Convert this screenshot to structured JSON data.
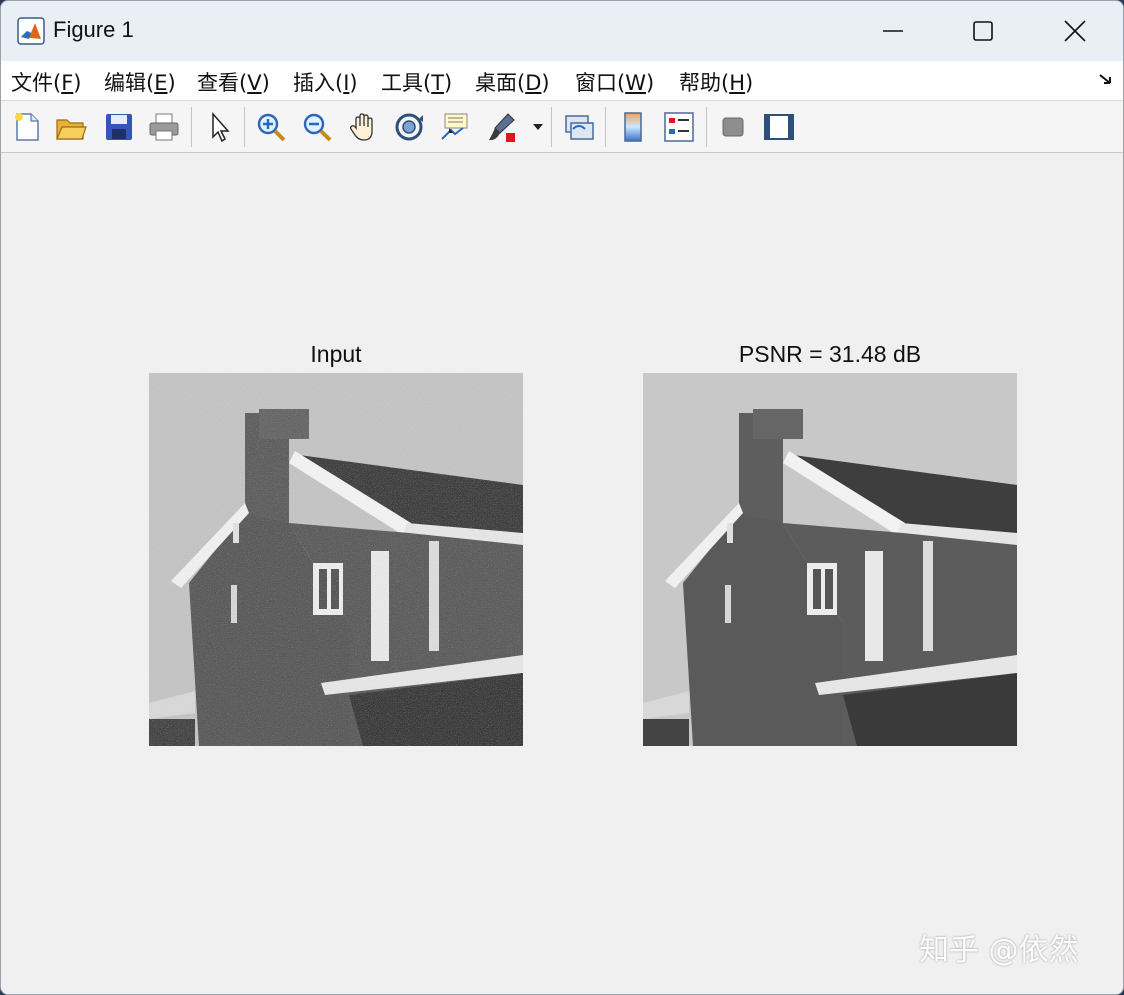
{
  "window": {
    "title": "Figure 1"
  },
  "menu": [
    {
      "label": "文件(",
      "acc": "F",
      "tail": ")"
    },
    {
      "label": "编辑(",
      "acc": "E",
      "tail": ")"
    },
    {
      "label": "查看(",
      "acc": "V",
      "tail": ")"
    },
    {
      "label": "插入(",
      "acc": "I",
      "tail": ")"
    },
    {
      "label": "工具(",
      "acc": "T",
      "tail": ")"
    },
    {
      "label": "桌面(",
      "acc": "D",
      "tail": ")"
    },
    {
      "label": "窗口(",
      "acc": "W",
      "tail": ")"
    },
    {
      "label": "帮助(",
      "acc": "H",
      "tail": ")"
    }
  ],
  "toolbar": {
    "icons": [
      "new-figure-icon",
      "open-file-icon",
      "save-icon",
      "print-icon",
      "select-arrow-icon",
      "zoom-in-icon",
      "zoom-out-icon",
      "pan-hand-icon",
      "rotate-3d-icon",
      "data-cursor-icon",
      "brush-icon",
      "link-plot-icon",
      "colorbar-icon",
      "legend-icon",
      "hide-plot-tools-icon",
      "show-plot-tools-icon"
    ]
  },
  "panels": {
    "left_title": "Input",
    "right_title": "PSNR = 31.48 dB"
  },
  "watermark": "知乎 @依然",
  "colors": {
    "titlebar": "#e8f0f6",
    "canvas": "#f0f0f0",
    "sky_noisy": "#c4c4c4",
    "sky_clean": "#c8c8c8",
    "wall": "#5a5a5a",
    "roof": "#3e3e3e",
    "trim": "#f2f2f2"
  }
}
